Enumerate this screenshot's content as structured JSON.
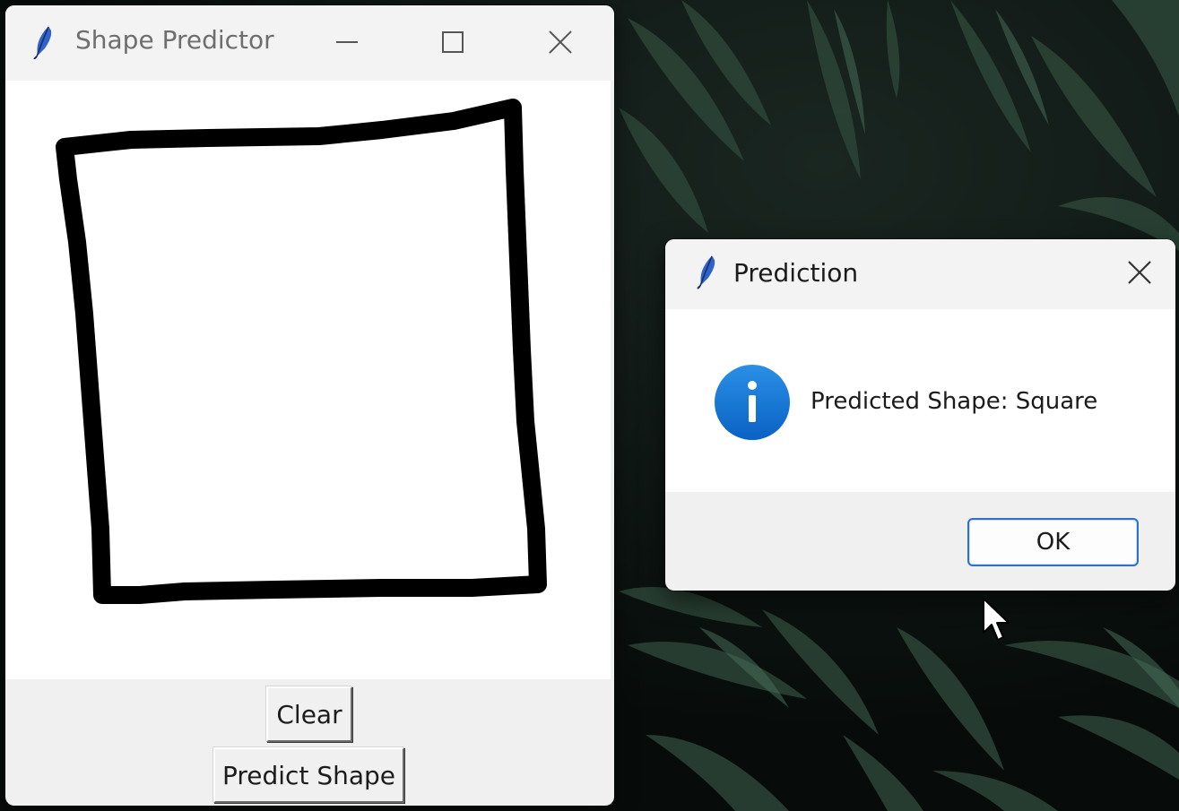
{
  "desktop": {
    "background_color": "#0d1512",
    "leaf_color": "#2f4a3c"
  },
  "main_window": {
    "title": "Shape Predictor",
    "title_icon": "feather-icon",
    "controls": [
      "minimize-icon",
      "maximize-icon",
      "close-icon"
    ],
    "drawing": {
      "shape_drawn": "square",
      "stroke_color": "#000000"
    },
    "buttons": {
      "clear_label": "Clear",
      "predict_label": "Predict Shape"
    }
  },
  "dialog": {
    "title": "Prediction",
    "title_icon": "feather-icon",
    "message_icon": "info-icon",
    "message": "Predicted Shape: Square",
    "ok_label": "OK",
    "accent_color": "#0f78d4"
  }
}
